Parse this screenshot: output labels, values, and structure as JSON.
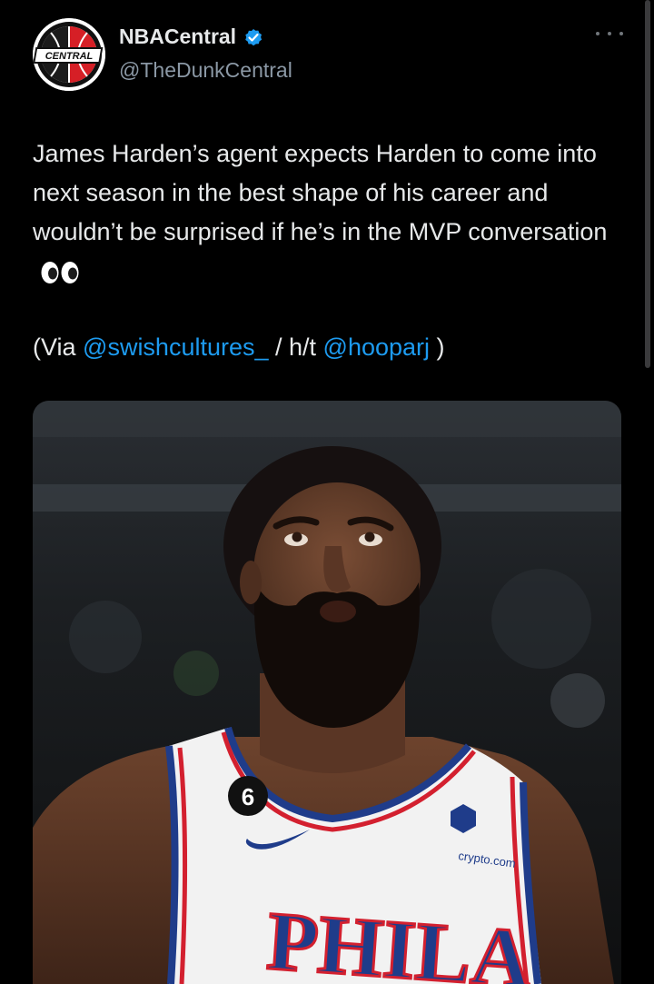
{
  "author": {
    "avatar_icon": "nba-central-logo-icon",
    "avatar_text": "CENTRAL",
    "name": "NBACentral",
    "handle": "@TheDunkCentral",
    "verified_icon": "verified-badge-icon",
    "verified_color": "#1d9bf0"
  },
  "more_icon": "more-options-icon",
  "tweet": {
    "text": "James Harden’s agent expects Harden to come into next season in the best shape of his career and wouldn’t be surprised if he’s in the MVP conversation",
    "emoji_icon": "eyes-emoji-icon",
    "via_prefix": "(Via ",
    "via_mention": "@swishcultures_",
    "ht_text": " / h/t ",
    "ht_mention": "@hooparj",
    "via_suffix": " )"
  },
  "media": {
    "jersey_number": "6",
    "sponsor_text": "crypto.com",
    "jersey_text": "PHILA"
  },
  "colors": {
    "background": "#000000",
    "text": "#e7e9ea",
    "secondary_text": "#8b98a5",
    "link": "#1d9bf0"
  }
}
